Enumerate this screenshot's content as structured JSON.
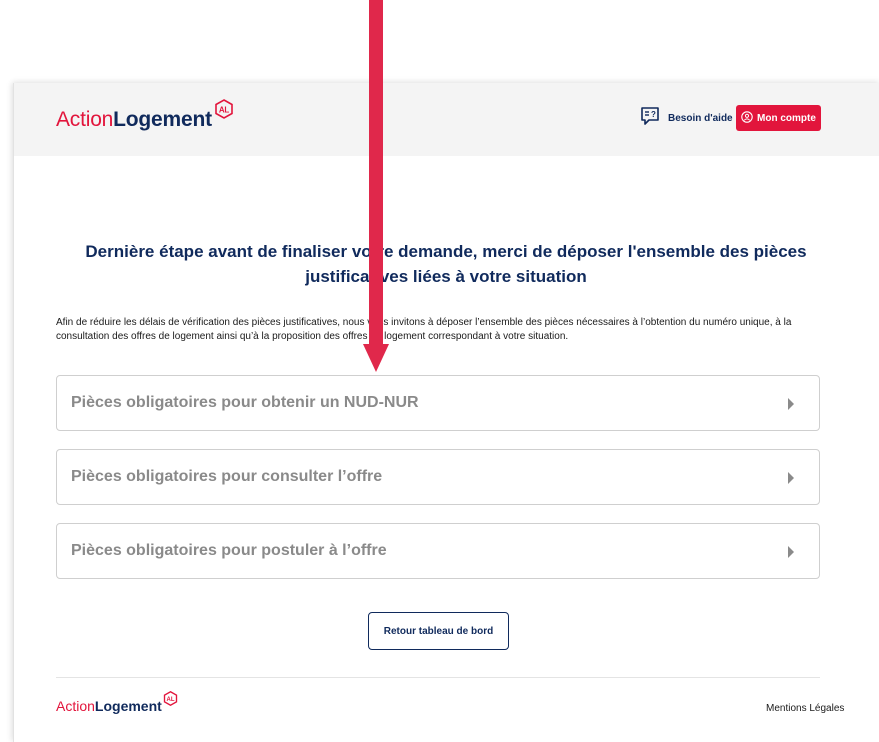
{
  "header": {
    "logo_light": "Action",
    "logo_bold": "Logement",
    "logo_badge": "AL",
    "help_label": "Besoin d'aide",
    "account_label": "Mon compte"
  },
  "main": {
    "title": "Dernière étape avant de finaliser votre demande, merci de déposer l'ensemble des pièces justificatives liées à votre situation",
    "intro": "Afin de réduire les délais de vérification des pièces justificatives, nous vous invitons à déposer l’ensemble des pièces nécessaires à l’obtention du numéro unique, à la consultation des offres de logement ainsi qu’à la proposition des offres de logement correspondant à votre situation.",
    "sections": [
      {
        "label": "Pièces obligatoires pour obtenir un NUD-NUR"
      },
      {
        "label": "Pièces obligatoires pour consulter l’offre"
      },
      {
        "label": "Pièces obligatoires pour postuler à l’offre"
      }
    ],
    "back_label": "Retour tableau de bord"
  },
  "footer": {
    "logo_light": "Action",
    "logo_bold": "Logement",
    "logo_badge": "AL",
    "legal_label": "Mentions Légales"
  },
  "annotation": {
    "arrow_color": "#e0284b"
  },
  "colors": {
    "brand_red": "#e2153c",
    "brand_navy": "#102a5c",
    "muted_gray": "#8a8a8a"
  }
}
